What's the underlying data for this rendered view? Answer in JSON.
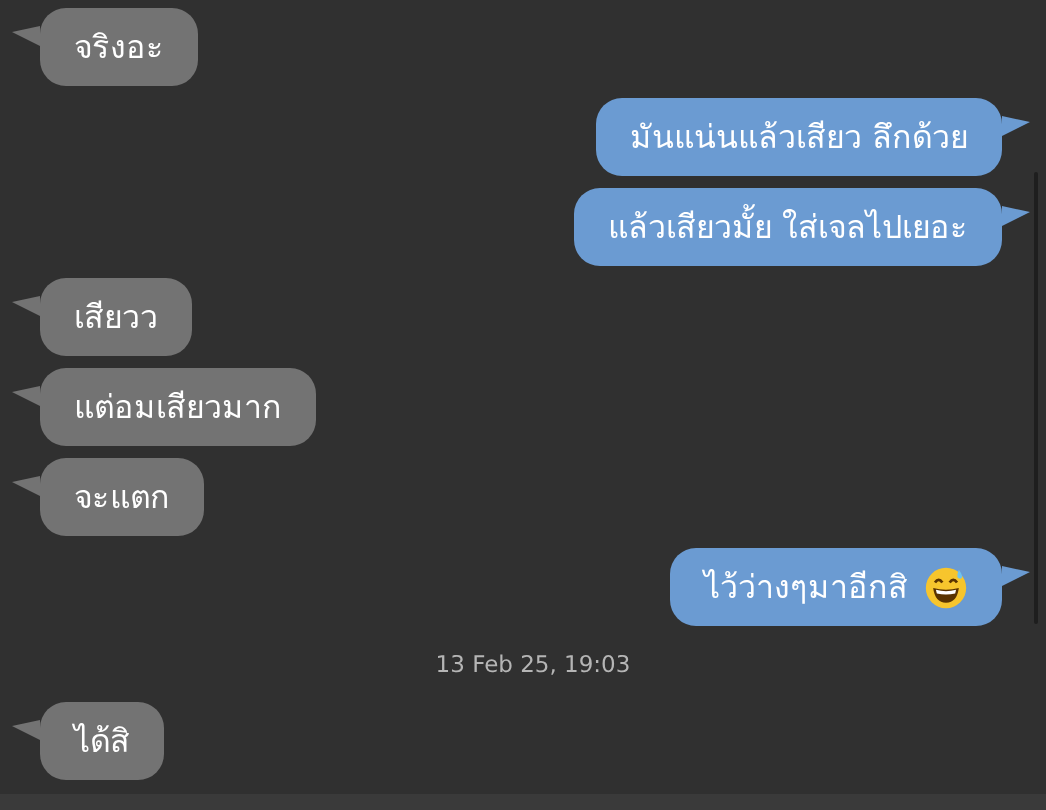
{
  "messages": [
    {
      "kind": "message",
      "sent": false,
      "text": "จริงอะ"
    },
    {
      "kind": "message",
      "sent": true,
      "text": "มันแน่นแล้วเสียว ลึกด้วย"
    },
    {
      "kind": "message",
      "sent": true,
      "text": "แล้วเสียวมั้ย ใส่เจลไปเยอะ"
    },
    {
      "kind": "message",
      "sent": false,
      "text": "เสียวว"
    },
    {
      "kind": "message",
      "sent": false,
      "text": "แต่อมเสียวมาก"
    },
    {
      "kind": "message",
      "sent": false,
      "text": "จะแตก"
    },
    {
      "kind": "message",
      "sent": true,
      "text": "ไว้ว่างๆมาอีกสิ",
      "emoji": true
    },
    {
      "kind": "timestamp",
      "text": "13 Feb 25, 19:03"
    },
    {
      "kind": "message",
      "sent": false,
      "text": "ได้สิ"
    }
  ]
}
